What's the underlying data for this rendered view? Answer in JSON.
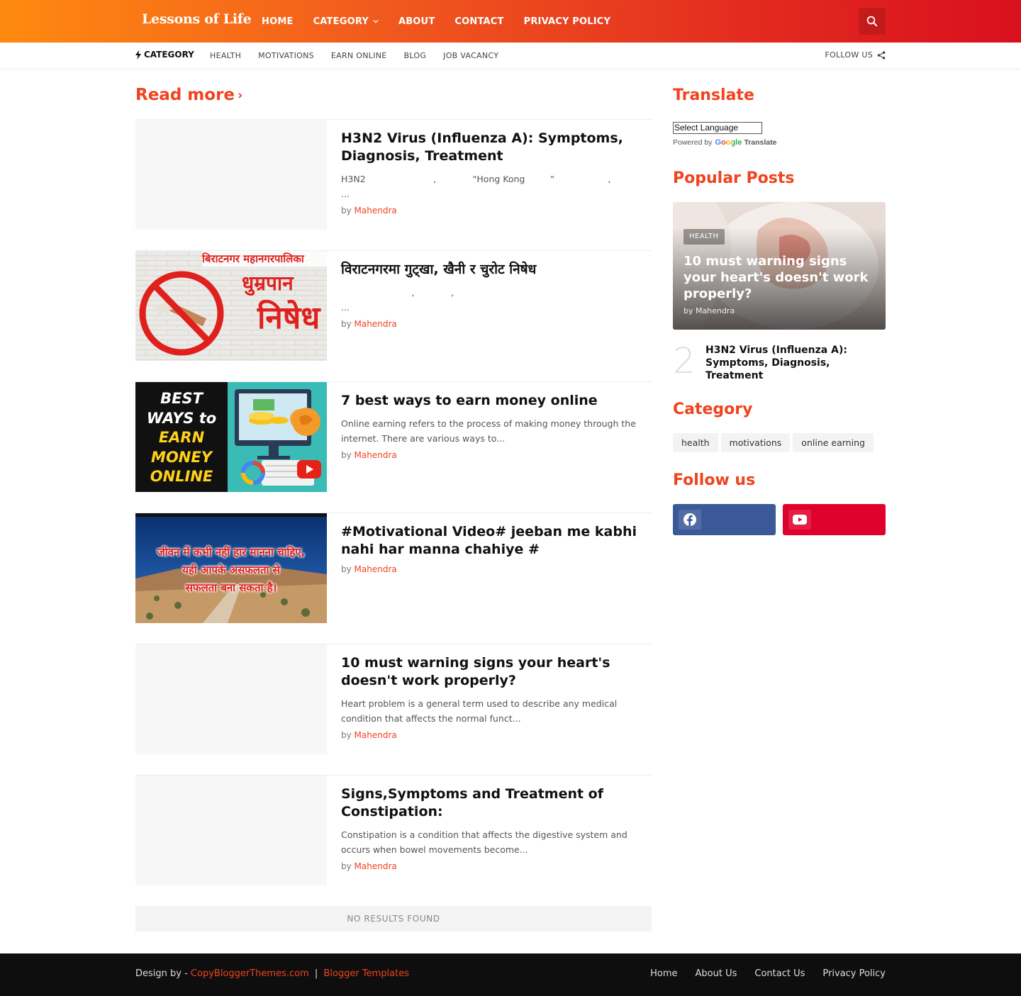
{
  "header": {
    "logo": "Lessons of Life",
    "nav": [
      "HOME",
      "CATEGORY",
      "ABOUT",
      "CONTACT",
      "PRIVACY POLICY"
    ]
  },
  "subbar": {
    "category_label": "CATEGORY",
    "links": [
      "HEALTH",
      "MOTIVATIONS",
      "EARN ONLINE",
      "BLOG",
      "JOB VACANCY"
    ],
    "follow_label": "FOLLOW US"
  },
  "main": {
    "read_more": "Read more",
    "posts": [
      {
        "title": "H3N2 Virus (Influenza A): Symptoms, Diagnosis, Treatment",
        "snippet": "H3N2                        ,             \"Hong Kong         \"                   ,                                                                           ...",
        "by": "by",
        "author": "Mahendra",
        "thumb": "blank"
      },
      {
        "title": "विराटनगरमा गुट्खा, खैनी र चुरोट निषेध",
        "snippet": "                         ,             ,                                                                                     ...",
        "by": "by",
        "author": "Mahendra",
        "thumb": "smoking",
        "thumb_text_1": "बिराटनगर महानगरपालिका",
        "thumb_text_2": "धुम्रपान",
        "thumb_text_3": "निषेध"
      },
      {
        "title": "7 best ways to earn money online",
        "snippet": "Online earning refers to the process of making money through the internet. There are various ways to...",
        "by": "by",
        "author": "Mahendra",
        "thumb": "earn",
        "thumb_lines": [
          "BEST",
          "WAYS to",
          "EARN",
          "MONEY",
          "ONLINE"
        ]
      },
      {
        "title": "#Motivational Video# jeeban me kabhi nahi har manna chahiye #",
        "snippet": "",
        "by": "by",
        "author": "Mahendra",
        "thumb": "motivation",
        "thumb_lines": [
          "जीवन में कभी नहीं हार मानना चाहिए,",
          "यही आपके असफलता से",
          "सफलता बना सकता है।"
        ]
      },
      {
        "title": "10 must warning signs your heart's doesn't work properly?",
        "snippet": "Heart problem is a general term used to describe any medical condition that affects the normal funct...",
        "by": "by",
        "author": "Mahendra",
        "thumb": "blank"
      },
      {
        "title": "Signs,Symptoms and Treatment of Constipation:",
        "snippet": "Constipation is a condition that affects the digestive system and occurs when bowel movements become...",
        "by": "by",
        "author": "Mahendra",
        "thumb": "blank"
      }
    ],
    "no_results": "NO RESULTS FOUND"
  },
  "sidebar": {
    "translate_heading": "Translate",
    "select_language": "Select Language",
    "powered_by": "Powered by",
    "google": "Google",
    "translate": "Translate",
    "popular_heading": "Popular Posts",
    "popular_main": {
      "badge": "HEALTH",
      "title": "10 must warning signs your heart's doesn't work properly?",
      "by": "by",
      "author": "Mahendra"
    },
    "popular_second": {
      "number": "2",
      "title": "H3N2 Virus (Influenza A): Symptoms, Diagnosis, Treatment"
    },
    "category_heading": "Category",
    "tags": [
      "health",
      "motivations",
      "online earning"
    ],
    "follow_heading": "Follow us",
    "social": [
      {
        "icon": "facebook-icon",
        "color": "#3b5998"
      },
      {
        "icon": "youtube-icon",
        "color": "#e0002c"
      }
    ]
  },
  "footer": {
    "design_by": "Design by - ",
    "credit_link_1": "CopyBloggerThemes.com",
    "separator": "|",
    "credit_link_2": "Blogger Templates",
    "links": [
      "Home",
      "About Us",
      "Contact Us",
      "Privacy Policy"
    ]
  },
  "colors": {
    "accent": "#f0431e",
    "header_start": "#ff8a10",
    "header_end": "#d9101e"
  }
}
